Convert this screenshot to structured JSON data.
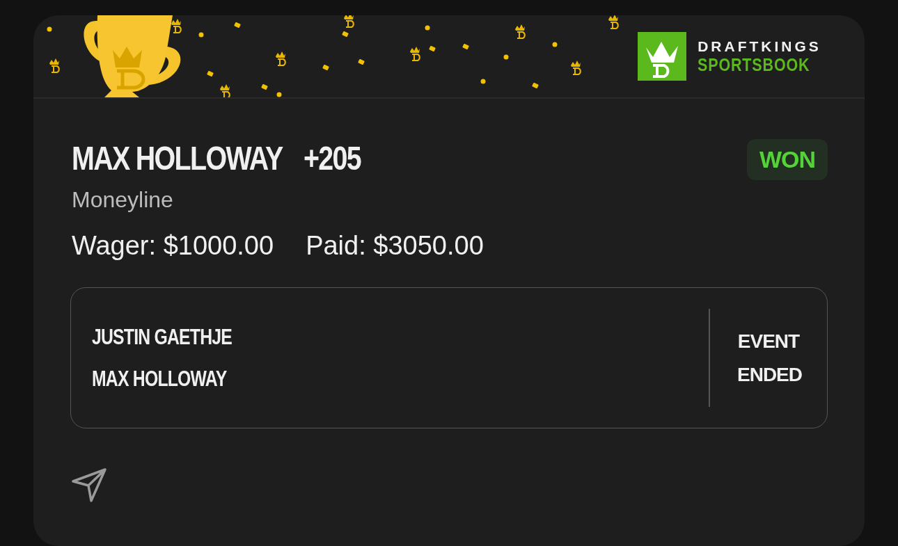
{
  "brand": {
    "line_1": "DRAFTKINGS",
    "line_2": "SPORTSBOOK"
  },
  "bet": {
    "selection": "MAX HOLLOWAY",
    "odds": "+205",
    "status": {
      "label": "WON",
      "kind": "won"
    },
    "market": "Moneyline",
    "wager": "Wager: $1000.00",
    "paid": "Paid: $3050.00"
  },
  "event": {
    "competitors": [
      "JUSTIN GAETHJE",
      "MAX HOLLOWAY"
    ],
    "status": "EVENT ENDED"
  }
}
